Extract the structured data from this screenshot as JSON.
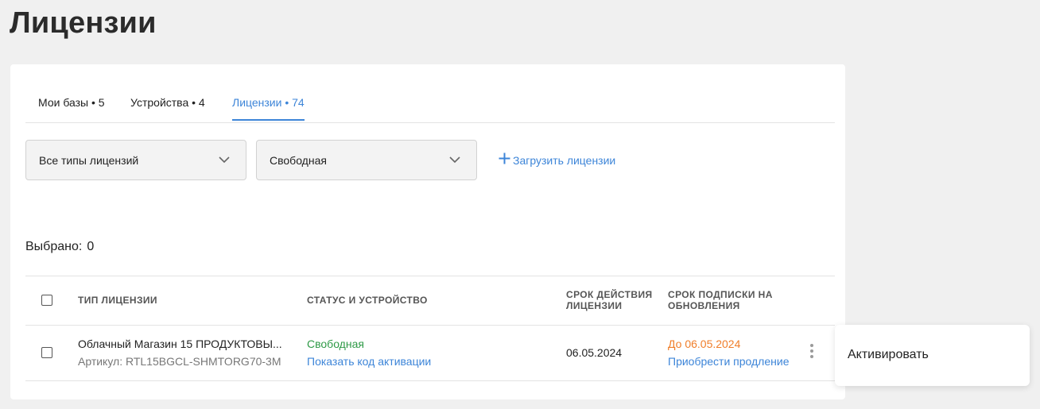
{
  "page": {
    "title": "Лицензии"
  },
  "tabs": [
    {
      "label": "Мои базы • 5",
      "active": false
    },
    {
      "label": "Устройства • 4",
      "active": false
    },
    {
      "label": "Лицензии • 74",
      "active": true
    }
  ],
  "filters": {
    "license_type": {
      "selected": "Все типы лицензий",
      "icon": "chevron-down-icon"
    },
    "status": {
      "selected": "Свободная",
      "icon": "chevron-down-icon"
    },
    "upload_label": "Загрузить лицензии",
    "upload_icon": "plus-icon"
  },
  "selection": {
    "label": "Выбрано:",
    "count": "0"
  },
  "table": {
    "columns": {
      "type": "ТИП ЛИЦЕНЗИИ",
      "status": "СТАТУС И УСТРОЙСТВО",
      "validity_line1": "СРОК ДЕЙСТВИЯ",
      "validity_line2": "ЛИЦЕНЗИИ",
      "subscription_line1": "СРОК ПОДПИСКИ НА",
      "subscription_line2": "ОБНОВЛЕНИЯ"
    },
    "rows": [
      {
        "name": "Облачный Магазин 15 ПРОДУКТОВЫ...",
        "article": "Артикул: RTL15BGCL-SHMTORG70-3M",
        "status": "Свободная",
        "activation_link": "Показать код активации",
        "validity": "06.05.2024",
        "subscription": "До 06.05.2024",
        "renew_link": "Приобрести продление"
      }
    ]
  },
  "context_menu": {
    "items": [
      "Активировать"
    ]
  },
  "colors": {
    "accent": "#3d85d8",
    "status_free": "#2f9a47",
    "subscription_warning": "#f07e2a"
  }
}
